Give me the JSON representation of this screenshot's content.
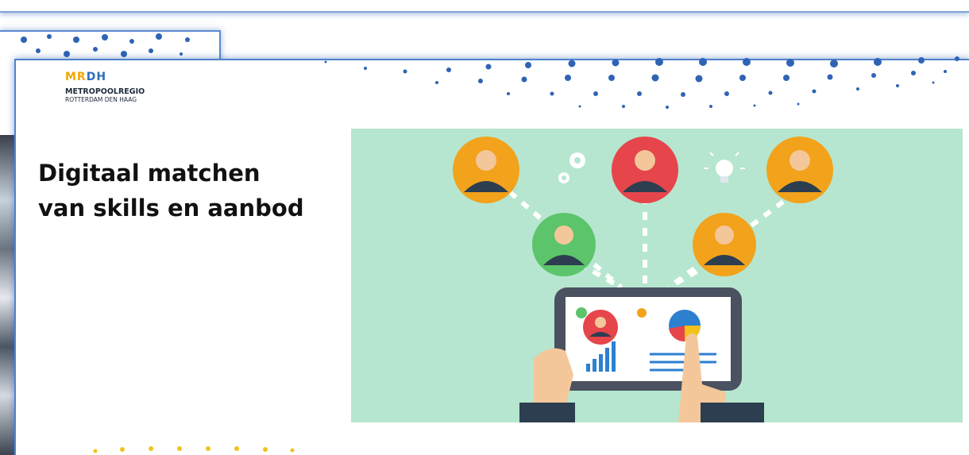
{
  "logo": {
    "mark_a": "MR",
    "mark_b": "DH",
    "line1": "METROPOOLREGIO",
    "line2": "ROTTERDAM DEN HAAG"
  },
  "slide": {
    "title": "Digitaal matchen van skills en aanbod"
  },
  "colors": {
    "accent_blue": "#2d6fb8",
    "illustration_bg": "#b6e6cf",
    "avatar_orange": "#f2a21b",
    "avatar_red": "#e5454b",
    "avatar_green": "#5cc46a"
  }
}
